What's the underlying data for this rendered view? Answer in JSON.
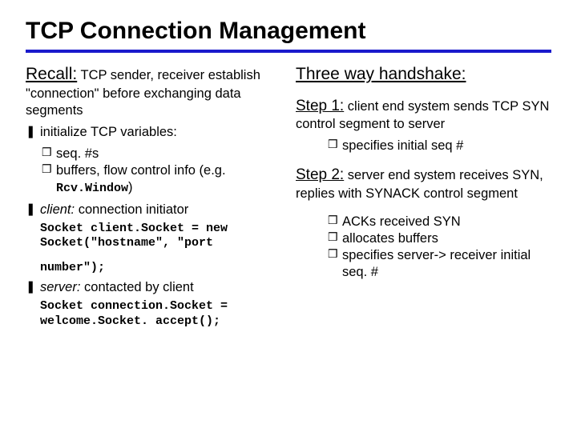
{
  "title": "TCP Connection Management",
  "bullets": {
    "z": "❚",
    "y": "❒"
  },
  "left": {
    "recall_label": "Recall:",
    "recall_rest": " TCP sender, receiver establish \"connection\" before exchanging data segments",
    "init": "initialize TCP variables:",
    "seq": "seq. #s",
    "buffers_a": "buffers, flow control info (e.g. ",
    "buffers_mono": "Rcv.Window",
    "buffers_b": ")",
    "client_lead": "client:",
    "client_rest": " connection initiator",
    "code1a": "Socket client.Socket = new",
    "code1b": "Socket(\"hostname\", \"port",
    "code1c": "number\");",
    "server_lead": "server:",
    "server_rest": " contacted by client",
    "code2a": "Socket connection.Socket =",
    "code2b": "welcome.Socket. accept();"
  },
  "right": {
    "heading": "Three way handshake:",
    "s1_label": "Step 1:",
    "s1_rest": " client end system sends TCP SYN control segment to server",
    "s1_b1": "specifies initial seq #",
    "s2_label": "Step 2:",
    "s2_rest": " server end system receives SYN, replies with SYNACK control segment",
    "s2_b1": "ACKs received SYN",
    "s2_b2": "allocates buffers",
    "s2_b3": "specifies server-> receiver initial seq. #"
  }
}
